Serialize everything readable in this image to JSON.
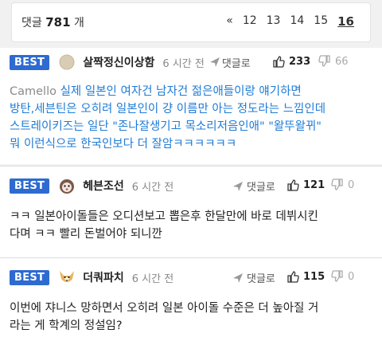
{
  "pager": {
    "label": "댓글",
    "count": "781",
    "unit": "개",
    "first": "«",
    "prev": "‹",
    "pages": [
      "12",
      "13",
      "14",
      "15"
    ],
    "current": "16"
  },
  "comments": [
    {
      "badge": "BEST",
      "nickname": "살짝정신이상함",
      "time": "6 시간 전",
      "reply": "댓글로",
      "up": "233",
      "down": "66",
      "quote": "Camello",
      "text_line1": " 실제 일본인 여자건 남자건 젊은애들이랑 얘기하면",
      "text_lines": [
        "방탄,세븐틴은 오히려 일본인이 걍 이름만 아는 정도라는 느낌인데",
        "스트레이키즈는 일단 \"존나잘생기고 목소리저음인애\" \"왈뚜왈뀌\"",
        "뭐 이런식으로 한국인보다 더 잘암ㅋㅋㅋㅋㅋㅋ"
      ]
    },
    {
      "badge": "BEST",
      "nickname": "헤븐조선",
      "time": "6 시간 전",
      "reply": "댓글로",
      "up": "121",
      "down": "0",
      "text_lines": [
        "ㅋㅋ 일본아이돌들은 오디션보고 뽑은후 한달만에 바로 데뷔시킨",
        "다며 ㅋㅋ 빨리 돈벌어야 되니깐"
      ]
    },
    {
      "badge": "BEST",
      "nickname": "더쿼파치",
      "time": "6 시간 전",
      "reply": "댓글로",
      "up": "115",
      "down": "0",
      "text_lines": [
        "이번에 쟈니스 망하면서 오히려 일본 아이돌 수준은 더 높아질 거",
        "라는 게 학계의 정설임?"
      ]
    }
  ],
  "icons": {
    "reply": "send-arrow-icon",
    "up": "thumbs-up-icon",
    "down": "thumbs-down-icon"
  },
  "colors": {
    "badge": "#2e6bd1",
    "link_text": "#1f7bd6",
    "background": "#f1f1f1"
  }
}
